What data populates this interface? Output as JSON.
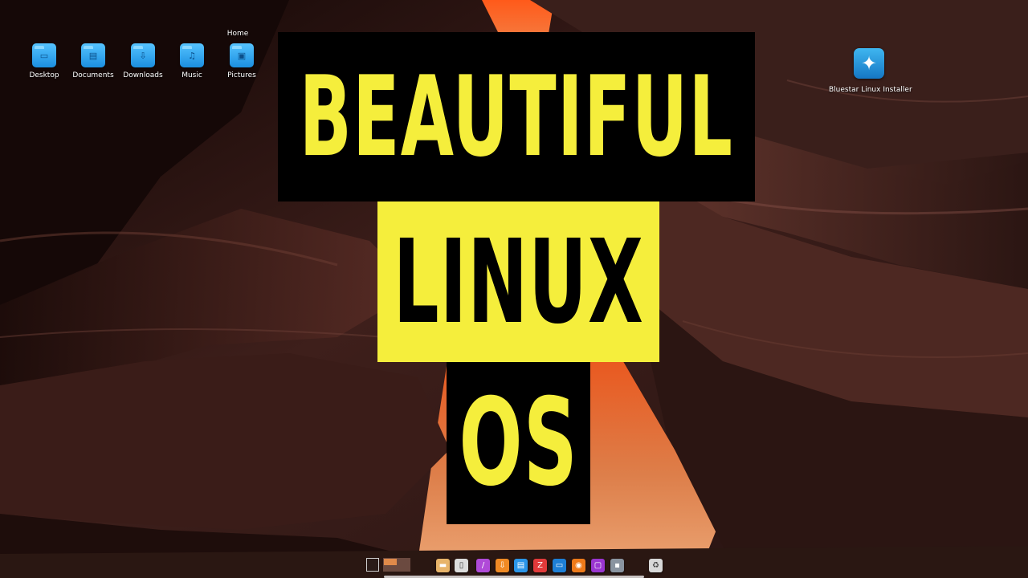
{
  "desktop": {
    "group_title": "Home",
    "folders": [
      {
        "label": "Desktop",
        "icon": "desktop-folder-icon",
        "glyph": "▭"
      },
      {
        "label": "Documents",
        "icon": "documents-folder-icon",
        "glyph": "▤"
      },
      {
        "label": "Downloads",
        "icon": "downloads-folder-icon",
        "glyph": "⇩"
      },
      {
        "label": "Music",
        "icon": "music-folder-icon",
        "glyph": "♫"
      },
      {
        "label": "Pictures",
        "icon": "pictures-folder-icon",
        "glyph": "▣"
      }
    ],
    "installer": {
      "label": "Bluestar Linux Installer",
      "icon": "compass-star-icon",
      "glyph": "✦"
    }
  },
  "thumbnail": {
    "line1": "BEAUTIFUL",
    "line2": "LINUX",
    "line3": "OS"
  },
  "dock": {
    "workspaces": [
      "workspace-1",
      "workspace-2"
    ],
    "apps": [
      {
        "icon": "file-manager-icon",
        "color": "#e8b46a",
        "glyph": "▬"
      },
      {
        "icon": "text-editor-icon",
        "color": "#dcdcdc",
        "glyph": "▯"
      },
      {
        "icon": "paint-brush-icon",
        "color": "#b04ad8",
        "glyph": "/"
      },
      {
        "icon": "package-installer-icon",
        "color": "#f08a24",
        "glyph": "⇩"
      },
      {
        "icon": "document-icon",
        "color": "#2b95e8",
        "glyph": "▤"
      },
      {
        "icon": "filezilla-icon",
        "color": "#e23a3a",
        "glyph": "Z"
      },
      {
        "icon": "screen-icon",
        "color": "#1e7fd6",
        "glyph": "▭"
      },
      {
        "icon": "firefox-icon",
        "color": "#ee7a1a",
        "glyph": "◉"
      },
      {
        "icon": "chat-icon",
        "color": "#9a35d0",
        "glyph": "▢"
      },
      {
        "icon": "settings-toggle-icon",
        "color": "#8a94a0",
        "glyph": "▪"
      },
      {
        "icon": "trash-icon",
        "color": "#d8d8d8",
        "glyph": "♻"
      }
    ]
  },
  "colors": {
    "title_yellow": "#f5ee3c",
    "title_black": "#000000",
    "folder_blue": "#2ba3ef"
  }
}
